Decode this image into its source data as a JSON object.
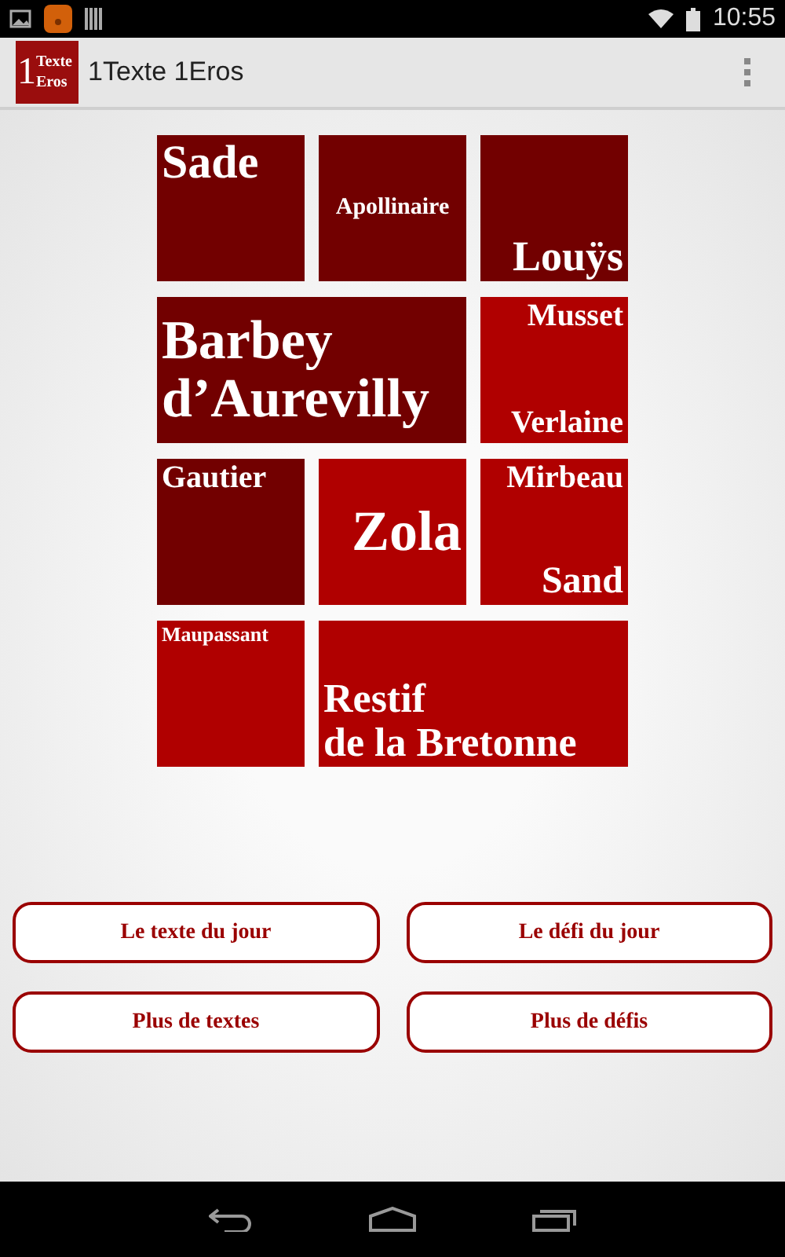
{
  "status_bar": {
    "time": "10:55"
  },
  "action_bar": {
    "logo": {
      "digit": "1",
      "top": "Texte",
      "bottom": "Eros"
    },
    "title": "1Texte 1Eros"
  },
  "tiles": [
    {
      "names": [
        "Sade"
      ],
      "color": "#720000"
    },
    {
      "names": [
        "Apollinaire"
      ],
      "color": "#720000"
    },
    {
      "names": [
        "Louÿs"
      ],
      "color": "#720000"
    },
    {
      "names": [
        "Barbey",
        "d’Aurevilly"
      ],
      "color": "#720000"
    },
    {
      "names": [
        "Musset",
        "Verlaine"
      ],
      "color": "#b00000"
    },
    {
      "names": [
        "Gautier"
      ],
      "color": "#720000"
    },
    {
      "names": [
        "Zola"
      ],
      "color": "#b00000"
    },
    {
      "names": [
        "Mirbeau",
        "Sand"
      ],
      "color": "#b00000"
    },
    {
      "names": [
        "Maupassant"
      ],
      "color": "#b00000"
    },
    {
      "names": [
        "Restif",
        "de la Bretonne"
      ],
      "color": "#b00000"
    }
  ],
  "buttons": [
    "Le texte du jour",
    "Le défi du jour",
    "Plus de textes",
    "Plus de défis"
  ]
}
